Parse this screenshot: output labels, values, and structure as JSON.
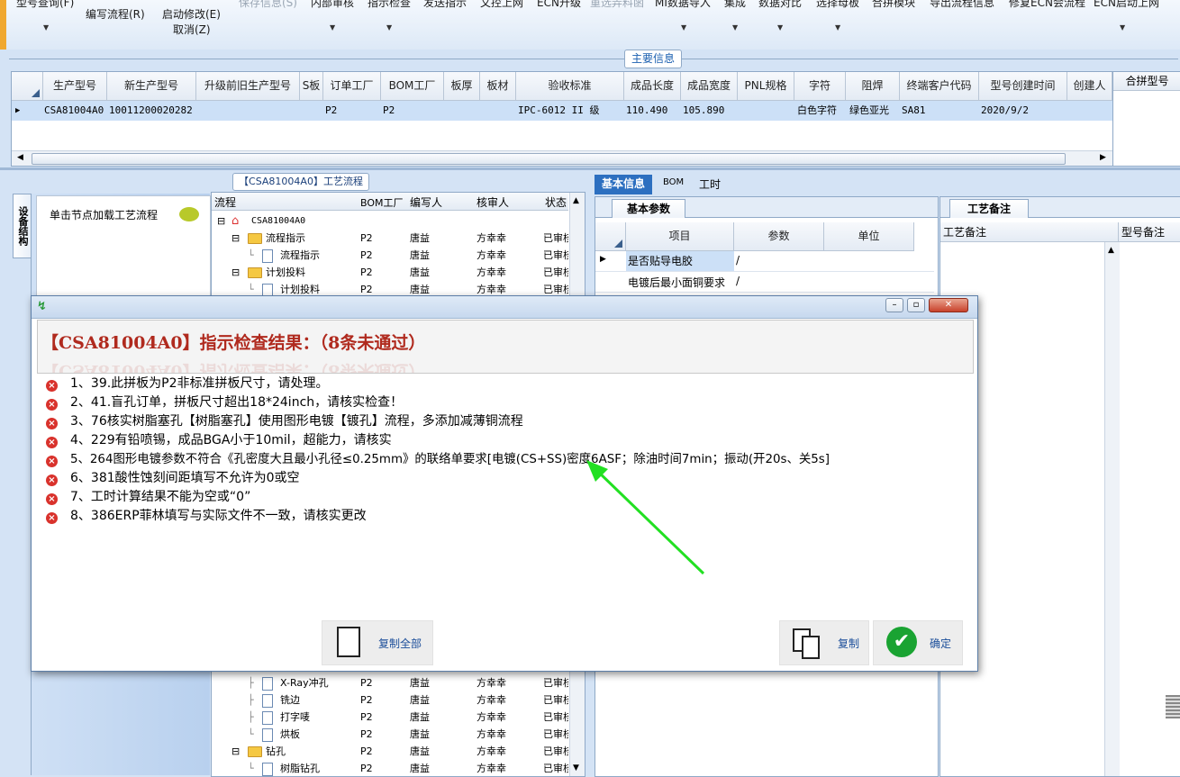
{
  "toolbar": {
    "items": [
      {
        "label": "型号查询(F)",
        "enabled": true
      },
      {
        "label": "编写流程(R)",
        "enabled": true
      },
      {
        "label": "启动修改(E)",
        "enabled": true
      },
      {
        "label": "取消(Z)",
        "enabled": true
      },
      {
        "label": "保存信息(S)",
        "enabled": false
      },
      {
        "label": "内部审核",
        "enabled": true
      },
      {
        "label": "指示检查",
        "enabled": true
      },
      {
        "label": "发送指示",
        "enabled": true
      },
      {
        "label": "文控上网",
        "enabled": true
      },
      {
        "label": "ECN升级",
        "enabled": true
      },
      {
        "label": "重选弄料函",
        "enabled": false
      },
      {
        "label": "MI数据导入",
        "enabled": true
      },
      {
        "label": "集成",
        "enabled": true
      },
      {
        "label": "数据对比",
        "enabled": true
      },
      {
        "label": "选择母板",
        "enabled": true
      },
      {
        "label": "合拼模块",
        "enabled": true
      },
      {
        "label": "导出流程信息",
        "enabled": true
      },
      {
        "label": "修复ECN会流程",
        "enabled": true
      },
      {
        "label": "ECN启动上网",
        "enabled": true
      }
    ]
  },
  "main_info": {
    "title": "主要信息",
    "columns": [
      "生产型号",
      "新生产型号",
      "升级前旧生产型号",
      "S板",
      "订单工厂",
      "BOM工厂",
      "板厚",
      "板材",
      "验收标准",
      "成品长度",
      "成品宽度",
      "PNL规格",
      "字符",
      "阻焊",
      "终端客户代码",
      "型号创建时间",
      "创建人"
    ],
    "row": [
      "CSA81004A0",
      "10011200020282",
      "",
      "",
      "P2",
      "P2",
      "",
      "",
      "IPC-6012 II 级",
      "110.490",
      "105.890",
      "",
      "白色字符",
      "绿色亚光",
      "SA81",
      "2020/9/2",
      ""
    ],
    "right_column": "合拼型号"
  },
  "side_panel": {
    "vertical_tab": "设备结构",
    "hint": "单击节点加载工艺流程"
  },
  "process_tree": {
    "title": "【CSA81004A0】工艺流程",
    "columns": [
      "流程",
      "BOM工厂",
      "编写人",
      "核审人",
      "状态"
    ],
    "rows_top": [
      {
        "name": "CSA81004A0",
        "bom": "",
        "writer": "",
        "reviewer": "",
        "status": "",
        "kind": "root"
      },
      {
        "name": "流程指示",
        "bom": "P2",
        "writer": "唐益",
        "reviewer": "方幸幸",
        "status": "已审核",
        "kind": "folder"
      },
      {
        "name": "流程指示",
        "bom": "P2",
        "writer": "唐益",
        "reviewer": "方幸幸",
        "status": "已审核",
        "kind": "doc"
      },
      {
        "name": "计划投料",
        "bom": "P2",
        "writer": "唐益",
        "reviewer": "方幸幸",
        "status": "已审核",
        "kind": "folder"
      },
      {
        "name": "计划投料",
        "bom": "P2",
        "writer": "唐益",
        "reviewer": "方幸幸",
        "status": "已审核",
        "kind": "doc"
      }
    ],
    "rows_bottom": [
      {
        "name": "X-Ray冲孔",
        "bom": "P2",
        "writer": "唐益",
        "reviewer": "方幸幸",
        "status": "已审核",
        "kind": "doc"
      },
      {
        "name": "铣边",
        "bom": "P2",
        "writer": "唐益",
        "reviewer": "方幸幸",
        "status": "已审核",
        "kind": "doc"
      },
      {
        "name": "打字唛",
        "bom": "P2",
        "writer": "唐益",
        "reviewer": "方幸幸",
        "status": "已审核",
        "kind": "doc"
      },
      {
        "name": "烘板",
        "bom": "P2",
        "writer": "唐益",
        "reviewer": "方幸幸",
        "status": "已审核",
        "kind": "doc"
      },
      {
        "name": "钻孔",
        "bom": "P2",
        "writer": "唐益",
        "reviewer": "方幸幸",
        "status": "已审核",
        "kind": "folder"
      },
      {
        "name": "树脂钻孔",
        "bom": "P2",
        "writer": "唐益",
        "reviewer": "方幸幸",
        "status": "已审核",
        "kind": "doc"
      }
    ]
  },
  "info_tabs": {
    "tabs": [
      "基本信息",
      "BOM",
      "工时"
    ],
    "sub_tab": "基本参数",
    "columns": [
      "项目",
      "参数",
      "单位"
    ],
    "rows": [
      {
        "item": "是否贴导电胶",
        "param": "/",
        "unit": ""
      },
      {
        "item": "电镀后最小面铜要求",
        "param": "/",
        "unit": ""
      }
    ]
  },
  "remarks": {
    "tab": "工艺备注",
    "col1": "工艺备注",
    "col2": "型号备注"
  },
  "dialog": {
    "heading": "【CSA81004A0】指示检查结果：（8条未通过）",
    "messages": [
      "1、39.此拼板为P2非标准拼板尺寸，请处理。",
      "2、41.盲孔订单，拼板尺寸超出18*24inch，请核实检查！",
      "3、76核实树脂塞孔【树脂塞孔】使用图形电镀【镀孔】流程，多添加减薄铜流程",
      "4、229有铅喷锡，成品BGA小于10mil，超能力，请核实",
      "5、264图形电镀参数不符合《孔密度大且最小孔径≤0.25mm》的联络单要求[电镀(CS+SS)密度6ASF；除油时间7min；振动(开20s、关5s]",
      "6、381酸性蚀刻间距填写不允许为0或空",
      "7、工时计算结果不能为空或“0”",
      "8、386ERP菲林填写与实际文件不一致，请核实更改"
    ],
    "copy_all": "复制全部",
    "copy": "复制",
    "ok": "确定",
    "error_color": "#d9322c",
    "heading_color": "#b02a1e",
    "arrow_color": "#22e022"
  }
}
